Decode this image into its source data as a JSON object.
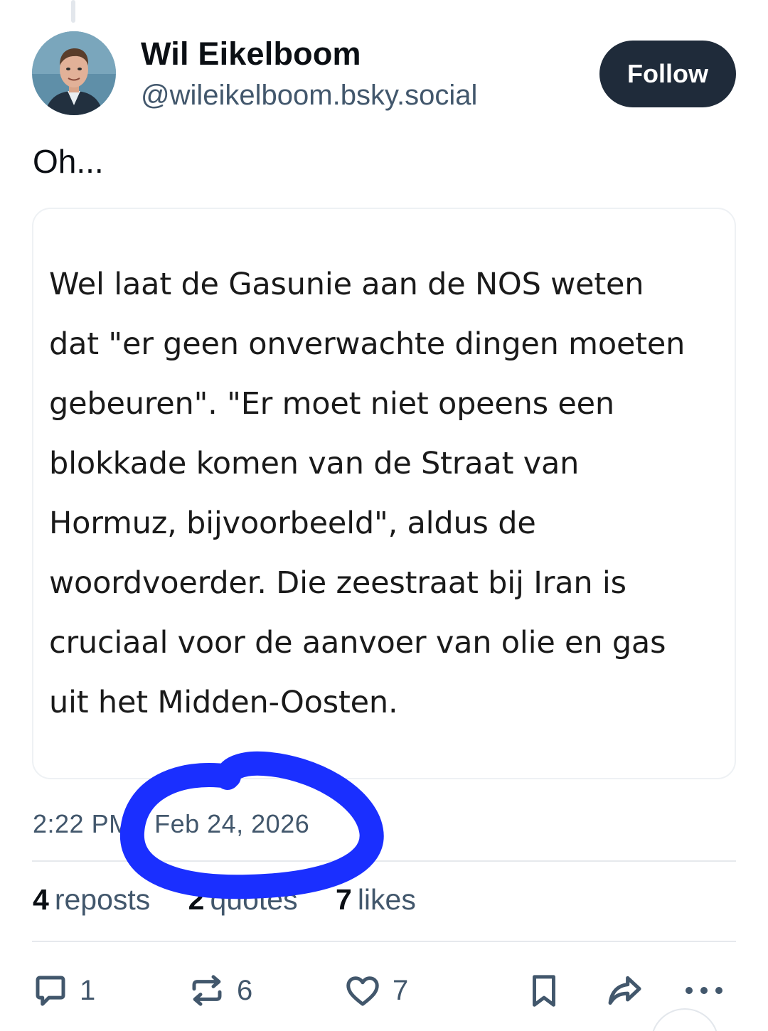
{
  "author": {
    "display_name": "Wil Eikelboom",
    "handle": "@wileikelboom.bsky.social"
  },
  "follow_label": "Follow",
  "post": {
    "text": "Oh...",
    "quote_lines": [
      "Wel laat de Gasunie aan de NOS weten",
      "dat \"er geen onverwachte dingen moeten",
      "gebeuren\". \"Er moet niet opeens een",
      "blokkade komen van de Straat van",
      "Hormuz, bijvoorbeeld\", aldus de",
      "woordvoerder. Die zeestraat bij Iran is",
      "cruciaal voor de aanvoer van olie en gas",
      "uit het Midden-Oosten."
    ],
    "time": "2:22 PM",
    "date": "Feb 24, 2026"
  },
  "stats": {
    "reposts": {
      "count": "4",
      "label": "reposts"
    },
    "quotes": {
      "count": "2",
      "label": "quotes"
    },
    "likes": {
      "count": "7",
      "label": "likes"
    }
  },
  "actions": {
    "reply": {
      "icon": "reply-icon",
      "count": "1"
    },
    "repost": {
      "icon": "repost-icon",
      "count": "6"
    },
    "like": {
      "icon": "heart-icon",
      "count": "7"
    },
    "bookmark": {
      "icon": "bookmark-icon"
    },
    "share": {
      "icon": "share-icon"
    },
    "more": {
      "icon": "more-icon"
    }
  },
  "colors": {
    "follow_bg": "#1f2b3a",
    "secondary_text": "#42576c",
    "annotation": "#1a2fff"
  }
}
